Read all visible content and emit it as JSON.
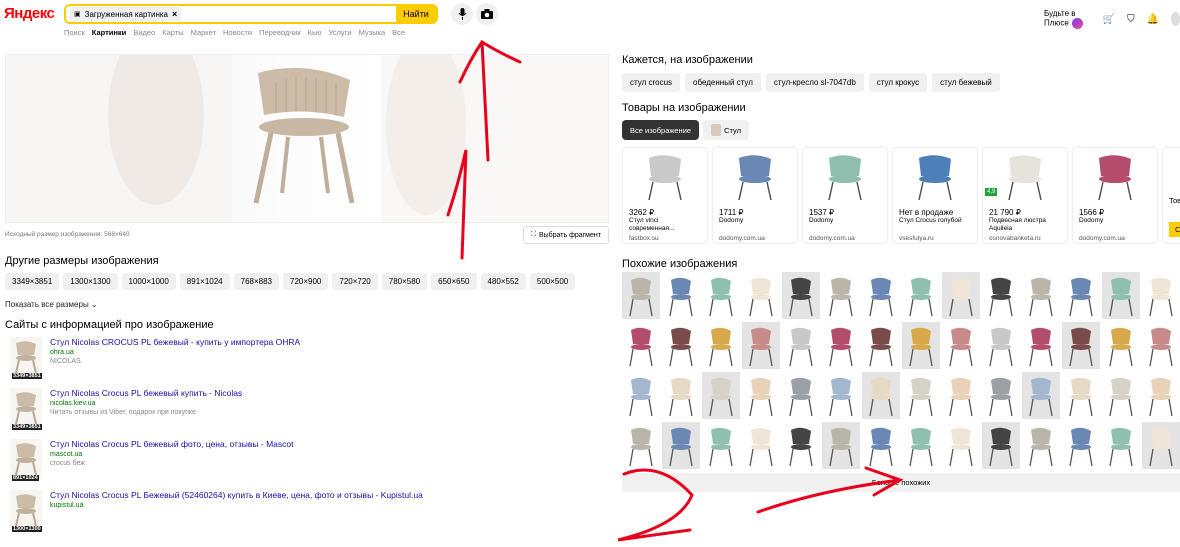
{
  "header": {
    "logo": "Яндекс",
    "search_chip": "Загруженная картинка",
    "find_label": "Найти",
    "plus_label": "Будьте в Плюсе"
  },
  "tabs": [
    "Поиск",
    "Картинки",
    "Видео",
    "Карты",
    "Маркет",
    "Новости",
    "Переводчик",
    "Кью",
    "Услуги",
    "Музыка",
    "Все"
  ],
  "active_tab": "Картинки",
  "main_image": {
    "original_size_label": "Исходный размер изображения: 568×640",
    "fragment_button": "Выбрать фрагмент"
  },
  "other_sizes": {
    "heading": "Другие размеры изображения",
    "sizes": [
      "3349×3851",
      "1300×1300",
      "1000×1000",
      "891×1024",
      "768×883",
      "720×900",
      "720×720",
      "780×580",
      "650×650",
      "480×552",
      "500×500"
    ],
    "show_all": "Показать все размеры"
  },
  "sites": {
    "heading": "Сайты с информацией про изображение",
    "items": [
      {
        "title": "Стул Nicolas CROCUS PL бежевый - купить у импортера OHRA",
        "host": "ohra.ua",
        "desc": "NICOLAS.",
        "dim": "3349×3851"
      },
      {
        "title": "Стул Nicolas Crocus PL бежевый купить - Nicolas",
        "host": "nicolas.kiev.ua",
        "desc": "Читать отзывы из Viber, подарок при покупке",
        "dim": "3349×3851"
      },
      {
        "title": "Стул Nicolas Crocus PL бежевый фото, цена, отзывы - Mascot",
        "host": "mascot.ua",
        "desc": "crocus беж",
        "dim": "891×1024"
      },
      {
        "title": "Стул Nicolas Crocus PL Бежевый (52460264) купить в Киеве, цена, фото и отзывы - Kupistul.ua",
        "host": "kupistul.ua",
        "desc": "",
        "dim": "1300×1300"
      }
    ]
  },
  "looks_like": {
    "heading": "Кажется, на изображении",
    "tags": [
      "стул crocus",
      "обеденный стул",
      "стул-кресло sl-7047db",
      "стул крокус",
      "стул бежевый"
    ]
  },
  "products": {
    "heading": "Товары на изображении",
    "tab_all": "Все изображение",
    "tab_chair": "Стул",
    "items": [
      {
        "price": "3262 ₽",
        "name": "Стул vinci современная...",
        "shop": "fastbox.su",
        "color": "#c9c9c9"
      },
      {
        "price": "1711 ₽",
        "name": "Dodomy",
        "shop": "dodomy.com.ua",
        "color": "#6b87b4"
      },
      {
        "price": "1537 ₽",
        "name": "Dodomy",
        "shop": "dodomy.com.ua",
        "color": "#8fbfae"
      },
      {
        "price": "Нет в продаже",
        "name": "Стул Crocus голубой",
        "shop": "vsesfulya.ru",
        "color": "#4f7fb8"
      },
      {
        "price": "21 790 ₽",
        "name": "Подвесная люстра Aquileia",
        "shop": "osnovabanketa.ru",
        "color": "#e6e3dc",
        "rating": "4,9"
      },
      {
        "price": "1566 ₽",
        "name": "Dodomy",
        "shop": "dodomy.com.ua",
        "color": "#b34d6b"
      }
    ],
    "partial_card_text": "Товаро",
    "partial_card_button": "Смот"
  },
  "similar": {
    "heading": "Похожие изображения",
    "more_label": "Больше похожих"
  },
  "colors": {
    "accent": "#ffcc00",
    "annotation": "#e8001c"
  }
}
